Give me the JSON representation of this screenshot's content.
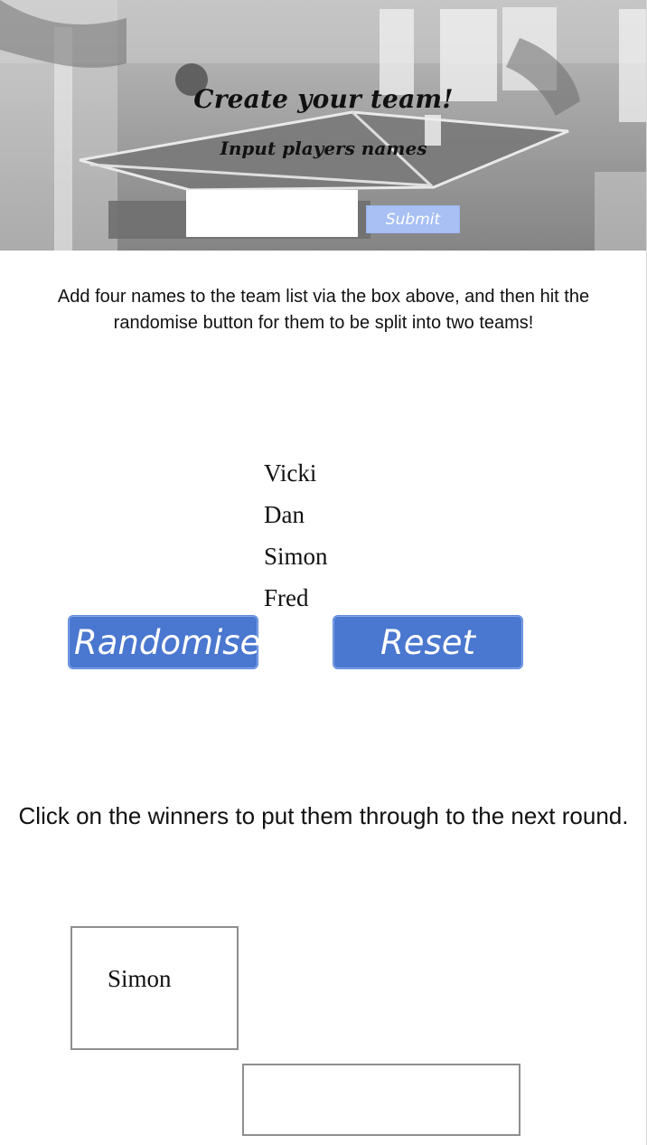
{
  "hero": {
    "title": "Create your team!",
    "subtitle": "Input players names",
    "input": {
      "value": "",
      "placeholder": ""
    },
    "submit_label": "Submit"
  },
  "instructions": "Add four names to the team list via the box above, and then hit the randomise button for them to be split into two teams!",
  "players": [
    {
      "name": "Vicki"
    },
    {
      "name": "Dan"
    },
    {
      "name": "Simon"
    },
    {
      "name": "Fred"
    }
  ],
  "actions": {
    "randomise_label": "Randomise",
    "reset_label": "Reset"
  },
  "round_note": "Click on the winners to put them through to the next round.",
  "bracket": {
    "match_1": {
      "player": "Simon"
    },
    "match_2": {
      "player": ""
    }
  },
  "colors": {
    "button": "#4a77cf",
    "submit": "#a8c0f3",
    "box_border": "#8f8f8f"
  }
}
